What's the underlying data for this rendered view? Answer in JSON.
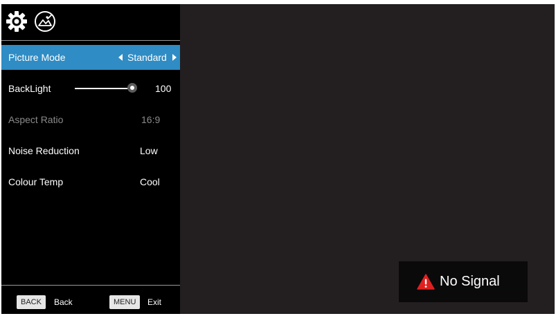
{
  "menu": {
    "tabs": [
      {
        "icon": "gear-icon"
      },
      {
        "icon": "picture-icon"
      }
    ],
    "items": [
      {
        "label": "Picture Mode",
        "value": "Standard"
      },
      {
        "label": "BackLight",
        "value": "100",
        "level": 1.0
      },
      {
        "label": "Aspect Ratio",
        "value": "16:9"
      },
      {
        "label": "Noise Reduction",
        "value": "Low"
      },
      {
        "label": "Colour Temp",
        "value": "Cool"
      }
    ],
    "selected_color": "#2f8cc4"
  },
  "footer": {
    "back_key": "BACK",
    "back_label": "Back",
    "menu_key": "MENU",
    "menu_label": "Exit"
  },
  "status": {
    "message": "No Signal",
    "icon": "warning-icon",
    "icon_color": "#e02020"
  }
}
